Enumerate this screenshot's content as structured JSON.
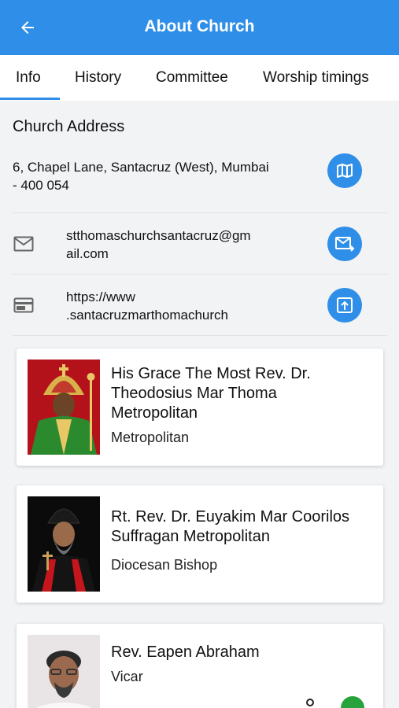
{
  "appbar": {
    "title": "About Church",
    "back_icon": "arrow-left-icon"
  },
  "tabs": [
    {
      "label": "Info",
      "selected": true
    },
    {
      "label": "History"
    },
    {
      "label": "Committee"
    },
    {
      "label": "Worship timings"
    }
  ],
  "accent_color": "#2f8fe8",
  "address": {
    "section_title": "Church Address",
    "line1": "6, Chapel Lane, Santacruz (West), Mumbai",
    "line2": "- 400 054",
    "action_icon": "map-icon"
  },
  "email": {
    "icon": "mail-icon",
    "line1": "stthomaschurchsantacruz@gm",
    "line2": "ail.com",
    "action_icon": "send-mail-icon"
  },
  "website": {
    "icon": "web-icon",
    "line1": "https://www",
    "line2": ".santacruzmarthomachurch",
    "action_icon": "open-link-icon"
  },
  "clergy": [
    {
      "name_lines": [
        "His Grace The Most Rev. Dr.",
        "Theodosius Mar Thoma",
        "Metropolitan"
      ],
      "role": "Metropolitan"
    },
    {
      "name_lines": [
        "Rt. Rev. Dr. Euyakim Mar Coorilos",
        "Suffragan Metropolitan"
      ],
      "role": "Diocesan Bishop"
    },
    {
      "name_lines": [
        "Rev. Eapen Abraham"
      ],
      "role": "Vicar"
    }
  ]
}
